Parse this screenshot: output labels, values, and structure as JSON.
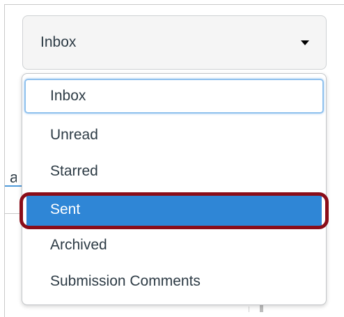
{
  "select": {
    "value": "Inbox",
    "caret_icon": "caret-down-icon"
  },
  "menu": {
    "items": [
      {
        "label": "Inbox",
        "state": "focused"
      },
      {
        "label": "Unread",
        "state": "normal"
      },
      {
        "label": "Starred",
        "state": "normal"
      },
      {
        "label": "Sent",
        "state": "selected"
      },
      {
        "label": "Archived",
        "state": "normal"
      },
      {
        "label": "Submission Comments",
        "state": "normal"
      }
    ]
  },
  "background": {
    "clipped_text": "a"
  },
  "colors": {
    "selected_background": "#2f86d6",
    "highlight_ring": "#8a0d19",
    "focus_ring": "#8fc1ee",
    "text": "#2d3b45"
  }
}
